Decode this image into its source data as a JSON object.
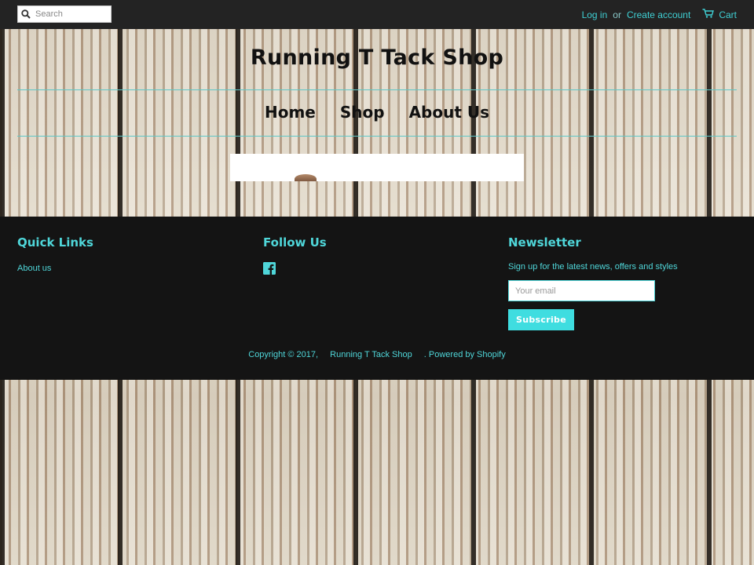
{
  "topbar": {
    "search": {
      "placeholder": "Search",
      "icon": "search-icon"
    },
    "login_label": "Log in",
    "or_label": "or",
    "create_account_label": "Create account",
    "cart_label": "Cart",
    "cart_icon": "cart-icon"
  },
  "header": {
    "site_title": "Running T Tack Shop",
    "nav": [
      {
        "label": "Home"
      },
      {
        "label": "Shop"
      },
      {
        "label": "About Us"
      }
    ]
  },
  "footer": {
    "quick_links": {
      "title": "Quick Links",
      "items": [
        {
          "label": "About us"
        }
      ]
    },
    "follow_us": {
      "title": "Follow Us",
      "icon": "facebook-icon"
    },
    "newsletter": {
      "title": "Newsletter",
      "text": "Sign up for the latest news, offers and styles",
      "email_placeholder": "Your email",
      "subscribe_label": "Subscribe"
    },
    "copyright": {
      "prefix": "Copyright © 2017,",
      "shop_name": "Running T Tack Shop",
      "suffix": ". Powered by Shopify"
    }
  },
  "colors": {
    "accent": "#4fd6d9",
    "topbar_bg": "#232323",
    "footer_bg": "#141414",
    "button_bg": "#3fdde0"
  }
}
